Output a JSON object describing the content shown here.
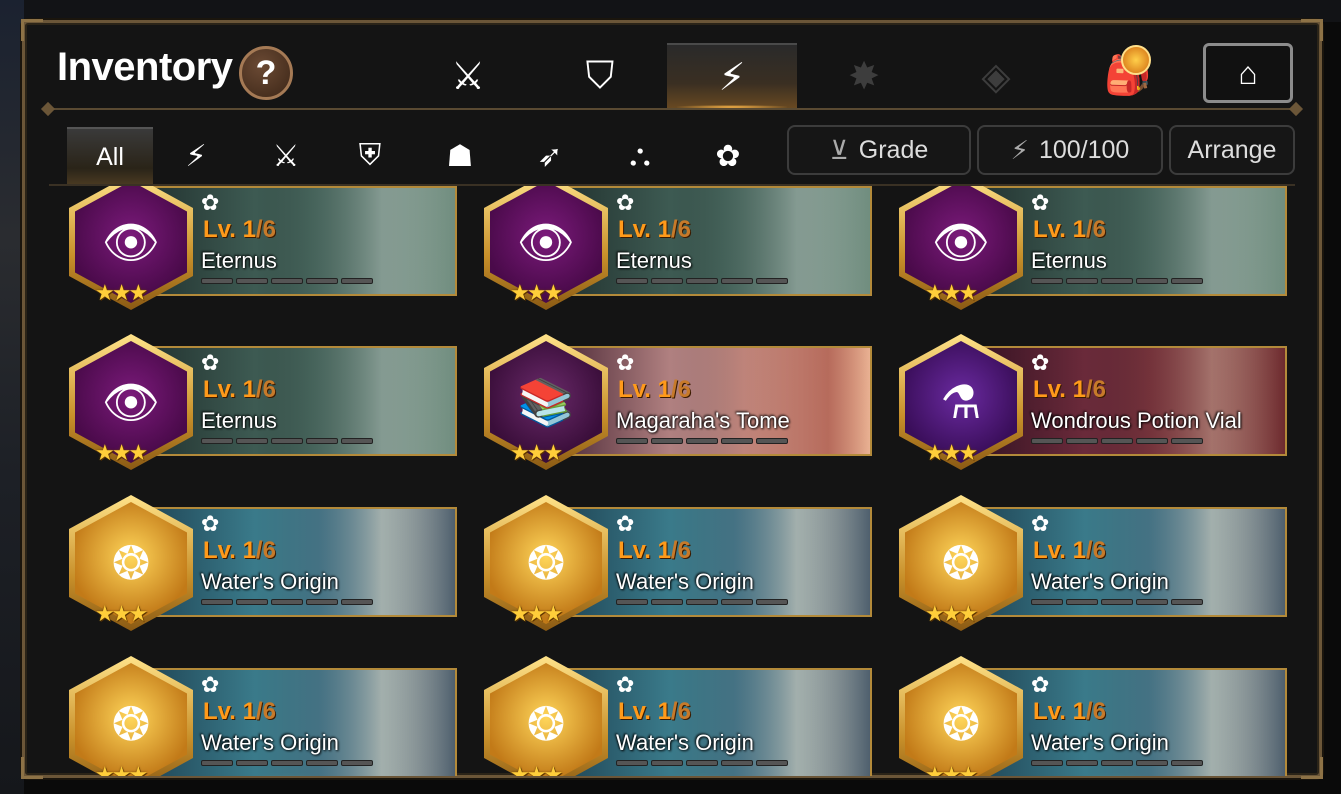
{
  "title": "Inventory",
  "help_label": "?",
  "top_tabs": [
    {
      "icon": "knight-shield-icon",
      "glyph": "⚔"
    },
    {
      "icon": "broken-shield-icon",
      "glyph": "⛉"
    },
    {
      "icon": "lightning-icon",
      "glyph": "⚡",
      "active": true
    },
    {
      "icon": "splash-icon",
      "glyph": "✸"
    },
    {
      "icon": "cube-icon",
      "glyph": "◈"
    },
    {
      "icon": "backpack-icon",
      "glyph": "🎒"
    }
  ],
  "home_icon": "home-icon",
  "filter_tabs": [
    {
      "label": "All",
      "active": true
    },
    {
      "icon": "orbit-lightning-icon",
      "glyph": "⚡"
    },
    {
      "icon": "crossed-swords-icon",
      "glyph": "⚔"
    },
    {
      "icon": "shield-icon",
      "glyph": "⛨"
    },
    {
      "icon": "hooded-figure-icon",
      "glyph": "☗"
    },
    {
      "icon": "bow-icon",
      "glyph": "➶"
    },
    {
      "icon": "wizard-hat-icon",
      "glyph": "⛬"
    },
    {
      "icon": "soul-weaver-icon",
      "glyph": "✿"
    }
  ],
  "controls": {
    "grade_label": "Grade",
    "capacity_label": "100/100",
    "arrange_label": "Arrange"
  },
  "items": [
    {
      "name": "Eternus",
      "level": "Lv. 1",
      "max": "/6",
      "theme": "eternus",
      "stars": "★★★"
    },
    {
      "name": "Eternus",
      "level": "Lv. 1",
      "max": "/6",
      "theme": "eternus",
      "stars": "★★★"
    },
    {
      "name": "Eternus",
      "level": "Lv. 1",
      "max": "/6",
      "theme": "eternus",
      "stars": "★★★"
    },
    {
      "name": "Eternus",
      "level": "Lv. 1",
      "max": "/6",
      "theme": "eternus",
      "stars": "★★★"
    },
    {
      "name": "Magaraha's Tome",
      "level": "Lv. 1",
      "max": "/6",
      "theme": "tome",
      "stars": "★★★"
    },
    {
      "name": "Wondrous Potion Vial",
      "level": "Lv. 1",
      "max": "/6",
      "theme": "potion",
      "stars": "★★★"
    },
    {
      "name": "Water's Origin",
      "level": "Lv. 1",
      "max": "/6",
      "theme": "water",
      "stars": "★★★"
    },
    {
      "name": "Water's Origin",
      "level": "Lv. 1",
      "max": "/6",
      "theme": "water",
      "stars": "★★★"
    },
    {
      "name": "Water's Origin",
      "level": "Lv. 1",
      "max": "/6",
      "theme": "water",
      "stars": "★★★"
    },
    {
      "name": "Water's Origin",
      "level": "Lv. 1",
      "max": "/6",
      "theme": "water",
      "stars": "★★★"
    },
    {
      "name": "Water's Origin",
      "level": "Lv. 1",
      "max": "/6",
      "theme": "water",
      "stars": "★★★"
    },
    {
      "name": "Water's Origin",
      "level": "Lv. 1",
      "max": "/6",
      "theme": "water",
      "stars": "★★★"
    }
  ],
  "colors": {
    "frame": "#6b5638",
    "level": "#ff9a1a",
    "star": "#ffce3a"
  }
}
